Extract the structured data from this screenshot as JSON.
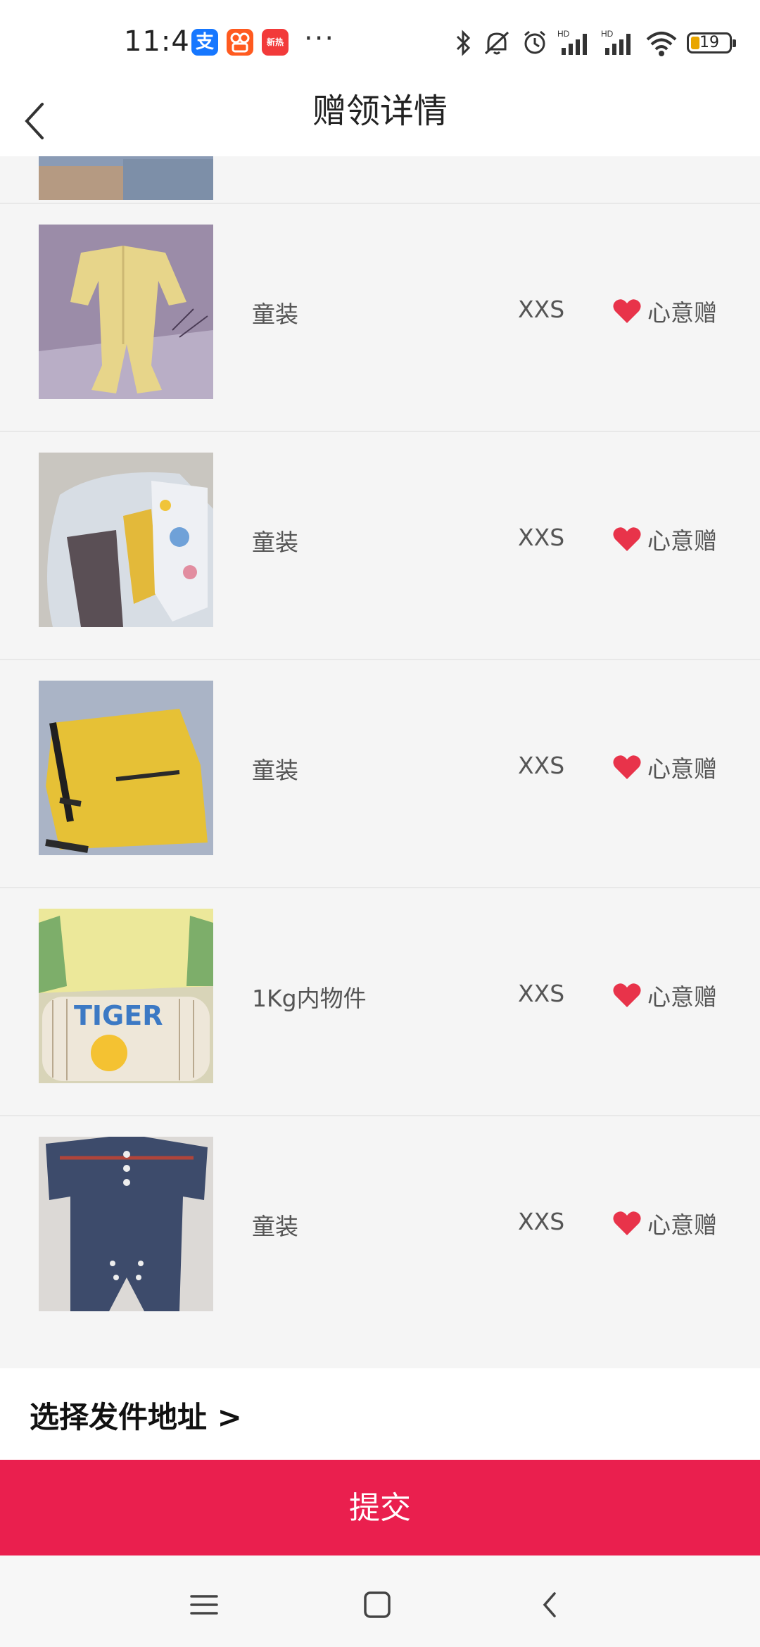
{
  "status_bar": {
    "time": "11:49",
    "apps": [
      "支",
      "",
      "新热"
    ],
    "more": "···",
    "battery": "19"
  },
  "header": {
    "title": "赠领详情"
  },
  "items": [
    {
      "category": "童装",
      "size": "XXS",
      "tag": "心意赠"
    },
    {
      "category": "童装",
      "size": "XXS",
      "tag": "心意赠"
    },
    {
      "category": "童装",
      "size": "XXS",
      "tag": "心意赠"
    },
    {
      "category": "1Kg内物件",
      "size": "XXS",
      "tag": "心意赠"
    },
    {
      "category": "童装",
      "size": "XXS",
      "tag": "心意赠"
    }
  ],
  "address": {
    "label": "选择发件地址 >"
  },
  "submit_label": "提交",
  "colors": {
    "accent": "#ea1f4e",
    "heart": "#e8334a"
  }
}
